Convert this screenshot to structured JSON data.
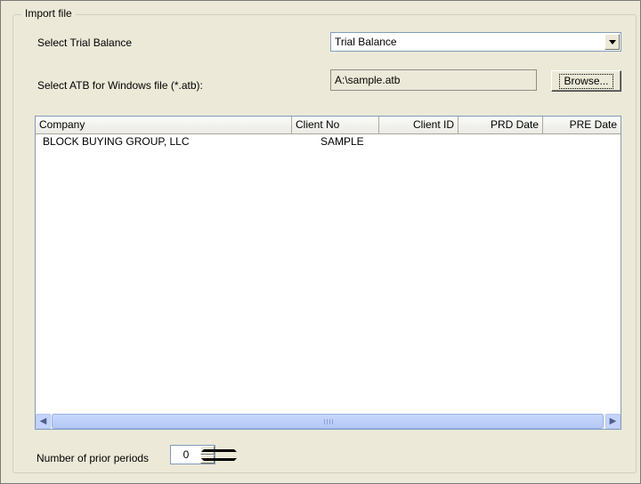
{
  "group": {
    "title": "Import file"
  },
  "trial_balance": {
    "label": "Select Trial Balance",
    "selected": "Trial Balance"
  },
  "atb_file": {
    "label": "Select ATB for Windows file (*.atb):",
    "value": "A:\\sample.atb",
    "browse_label": "Browse..."
  },
  "list": {
    "columns": [
      "Company",
      "Client No",
      "Client ID",
      "PRD Date",
      "PRE Date"
    ],
    "rows": [
      {
        "company": "BLOCK BUYING GROUP, LLC",
        "client_no": "SAMPLE",
        "client_id": "",
        "prd_date": "",
        "pre_date": ""
      }
    ]
  },
  "prior_periods": {
    "label": "Number of prior periods",
    "value": "0"
  },
  "icons": {
    "dropdown": "chevron-down-icon",
    "scroll_left": "arrow-left-icon",
    "scroll_right": "arrow-right-icon",
    "spin_up": "arrow-up-icon",
    "spin_down": "arrow-down-icon"
  },
  "colors": {
    "dialog_bg": "#ece9d8",
    "field_border": "#7f9db9",
    "scrollbar": "#c3d3fd"
  }
}
